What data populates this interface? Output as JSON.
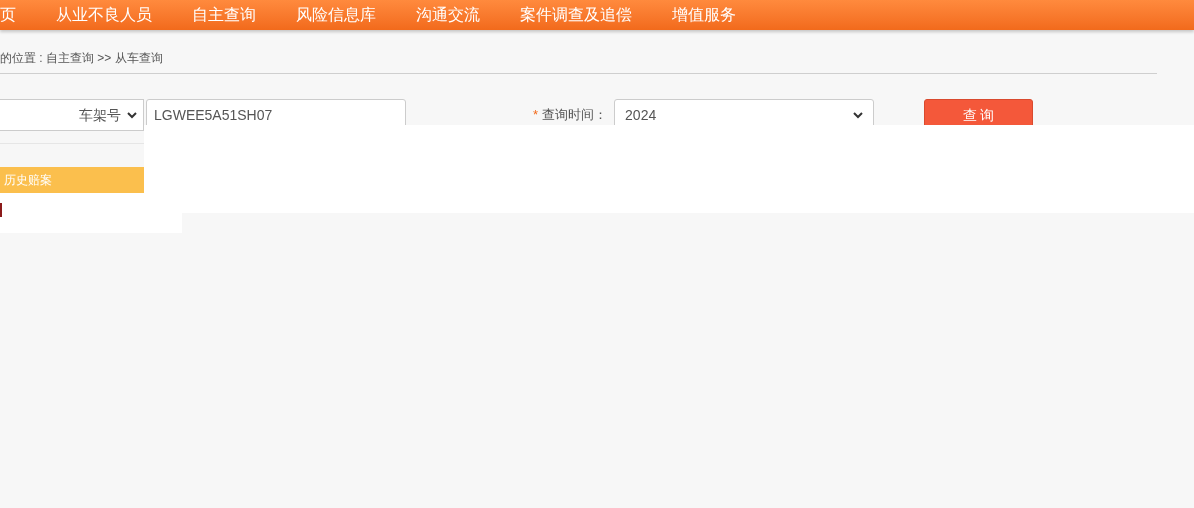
{
  "nav": {
    "items": [
      {
        "label": "页"
      },
      {
        "label": "从业不良人员"
      },
      {
        "label": "自主查询"
      },
      {
        "label": "风险信息库"
      },
      {
        "label": "沟通交流"
      },
      {
        "label": "案件调查及追偿"
      },
      {
        "label": "增值服务"
      }
    ]
  },
  "breadcrumb": "的位置 : 自主查询 >> 从车查询",
  "search": {
    "type_select": "车架号",
    "vin_value": "LGWEE5A51SH07",
    "required_mark": "*",
    "time_label": "查询时间：",
    "time_select": "2024",
    "button": "查 询"
  },
  "tabs": [
    {
      "label": "历史赔案",
      "selected": true
    }
  ]
}
